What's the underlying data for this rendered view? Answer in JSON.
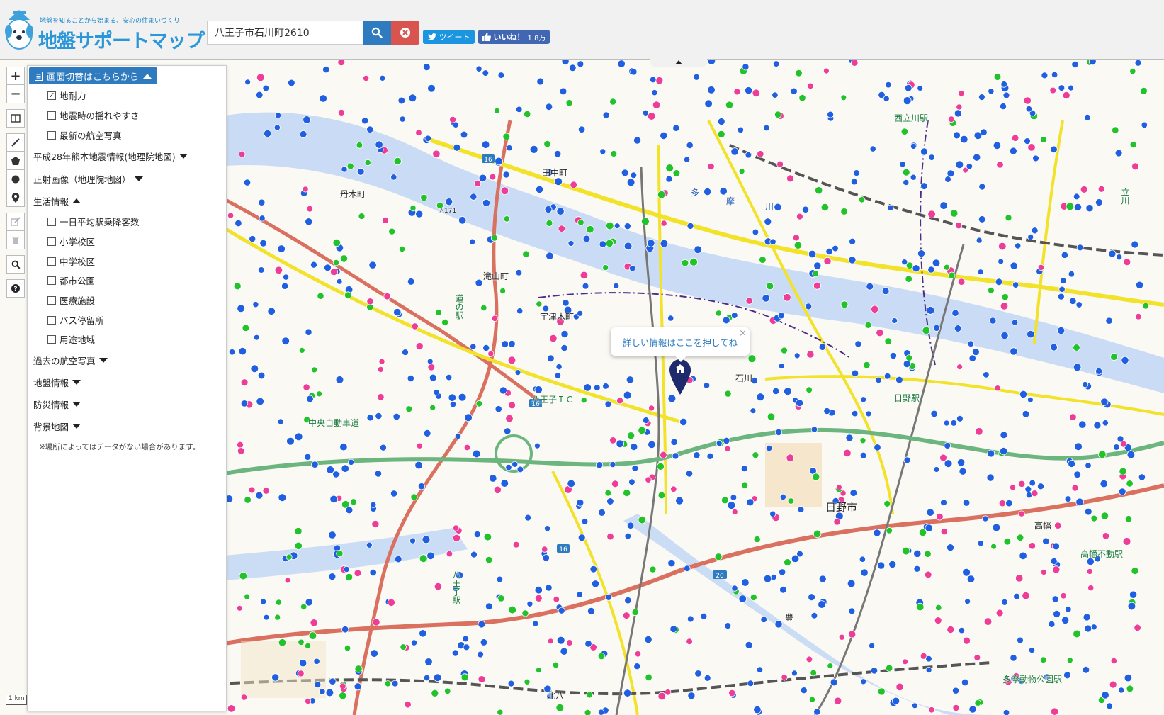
{
  "header": {
    "logo_tagline": "地盤を知ることから始まる、安心の住まいづくり",
    "logo_title": "地盤サポートマップ",
    "search_value": "八王子市石川町2610",
    "tweet_label": "ツイート",
    "like_label": "いいね！",
    "like_count": "1.8万"
  },
  "panel": {
    "switch_label": "画面切替はこちらから",
    "layers": [
      {
        "label": "地耐力",
        "checked": true
      },
      {
        "label": "地震時の揺れやすさ",
        "checked": false
      },
      {
        "label": "最新の航空写真",
        "checked": false
      }
    ],
    "sections": {
      "kumamoto": "平成28年熊本地震情報(地理院地図)",
      "ortho": "正射画像（地理院地図）",
      "life": "生活情報",
      "past_aerial": "過去の航空写真",
      "ground": "地盤情報",
      "disaster": "防災情報",
      "background": "背景地図"
    },
    "life_items": [
      "一日平均駅乗降客数",
      "小学校区",
      "中学校区",
      "都市公園",
      "医療施設",
      "バス停留所",
      "用途地域"
    ],
    "note": "※場所によってはデータがない場合があります。"
  },
  "map": {
    "popup_text": "詳しい情報はここを押してね",
    "scale_label": "1 km",
    "labels": {
      "tanaka": "田中町",
      "nishitachikawa": "西立川駅",
      "tamagawa_a": "多",
      "tamagawa_b": "摩",
      "tamagawa_c": "川",
      "tangi": "丹木町",
      "elev": "△171",
      "takiyama": "滝山町",
      "michi_no_eki": "道の駅",
      "utsuki": "宇津木町",
      "hachioji_ic": "八王子ＩＣ",
      "chuo_exp": "中央自動車道",
      "ishikawa": "石川",
      "hino_st": "日野駅",
      "hino_city": "日野市",
      "tachikawa": "立川",
      "hachioji_st": "八王子駅",
      "takahata": "高幡",
      "tama_zoo": "多摩動物公園駅",
      "takahata_fudo": "高幡不動駅",
      "toyoda": "豊",
      "kitahachi": "北八"
    },
    "route_numbers": [
      "16",
      "16",
      "16",
      "20"
    ]
  },
  "colors": {
    "accent": "#2f7bbf",
    "danger": "#d9534f",
    "dot_blue": "#1f5fe0",
    "dot_pink": "#ee3d96",
    "dot_green": "#22c22a",
    "expressway": "#6db57e",
    "road_yellow": "#f2e22a",
    "road_red": "#d97060",
    "river": "#a9c8f0",
    "marker": "#1e2a6b"
  },
  "icons": {
    "search": "search-icon",
    "clear": "clear-icon",
    "zoom_in": "plus-icon",
    "zoom_out": "minus-icon",
    "home": "home-icon"
  }
}
